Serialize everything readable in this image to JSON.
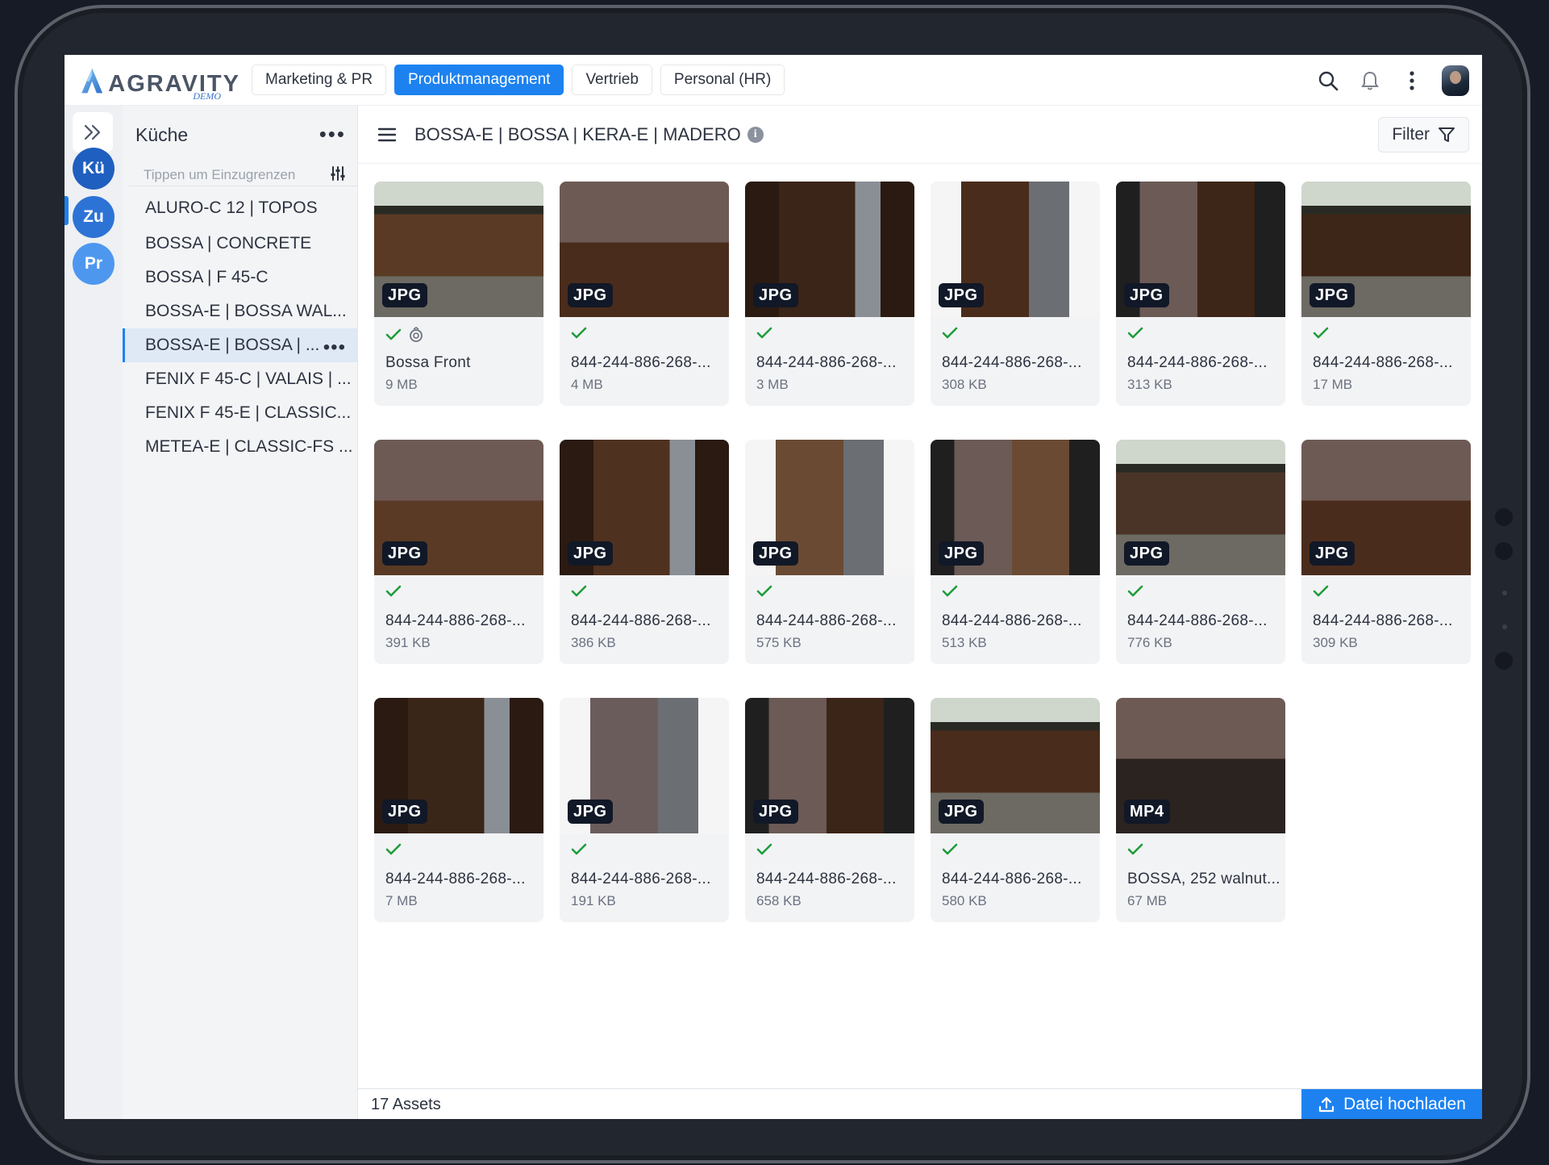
{
  "app": {
    "logo_text": "AGRAVITY",
    "logo_sub": "DEMO"
  },
  "tabs": [
    {
      "label": "Marketing & PR",
      "active": false
    },
    {
      "label": "Produktmanagement",
      "active": true
    },
    {
      "label": "Vertrieb",
      "active": false
    },
    {
      "label": "Personal (HR)",
      "active": false
    }
  ],
  "top_actions": [
    "search-icon",
    "bell-icon",
    "more-vertical-icon",
    "user-avatar"
  ],
  "rail": {
    "items": [
      {
        "label": "Kü",
        "color": "#1f5fbf"
      },
      {
        "label": "Zu",
        "color": "#2d73d6"
      },
      {
        "label": "Pr",
        "color": "#4e97ef"
      }
    ]
  },
  "tree": {
    "title": "Küche",
    "search_placeholder": "Tippen um Einzugrenzen",
    "items": [
      {
        "label": "ALURO-C 12 | TOPOS"
      },
      {
        "label": "BOSSA | CONCRETE"
      },
      {
        "label": "BOSSA | F 45-C"
      },
      {
        "label": "BOSSA-E | BOSSA WAL..."
      },
      {
        "label": "BOSSA-E | BOSSA | ...",
        "selected": true
      },
      {
        "label": "FENIX F 45-C | VALAIS | ..."
      },
      {
        "label": "FENIX F 45-E | CLASSIC..."
      },
      {
        "label": "METEA-E | CLASSIC-FS ..."
      }
    ]
  },
  "main": {
    "breadcrumb": "BOSSA-E | BOSSA | KERA-E | MADERO",
    "filter_label": "Filter",
    "assets": [
      {
        "type": "JPG",
        "name": "Bossa Front",
        "size": "9 MB",
        "extra_icon": true,
        "tone": "#5a3a24"
      },
      {
        "type": "JPG",
        "name": "844-244-886-268-...",
        "size": "4 MB",
        "tone": "#4a2c1c"
      },
      {
        "type": "JPG",
        "name": "844-244-886-268-...",
        "size": "3 MB",
        "tone": "#3b2418"
      },
      {
        "type": "JPG",
        "name": "844-244-886-268-...",
        "size": "308 KB",
        "tone": "#4a2c1c"
      },
      {
        "type": "JPG",
        "name": "844-244-886-268-...",
        "size": "313 KB",
        "tone": "#3d2517"
      },
      {
        "type": "JPG",
        "name": "844-244-886-268-...",
        "size": "17 MB",
        "tone": "#3d2517"
      },
      {
        "type": "JPG",
        "name": "844-244-886-268-...",
        "size": "391 KB",
        "tone": "#5a3a24"
      },
      {
        "type": "JPG",
        "name": "844-244-886-268-...",
        "size": "386 KB",
        "tone": "#4f3120"
      },
      {
        "type": "JPG",
        "name": "844-244-886-268-...",
        "size": "575 KB",
        "tone": "#6a4a33"
      },
      {
        "type": "JPG",
        "name": "844-244-886-268-...",
        "size": "513 KB",
        "tone": "#6a4a33"
      },
      {
        "type": "JPG",
        "name": "844-244-886-268-...",
        "size": "776 KB",
        "tone": "#4a3428"
      },
      {
        "type": "JPG",
        "name": "844-244-886-268-...",
        "size": "309 KB",
        "tone": "#4a2c1c"
      },
      {
        "type": "JPG",
        "name": "844-244-886-268-...",
        "size": "7 MB",
        "tone": "#3a2618"
      },
      {
        "type": "JPG",
        "name": "844-244-886-268-...",
        "size": "191 KB",
        "tone": "#6b5c5c"
      },
      {
        "type": "JPG",
        "name": "844-244-886-268-...",
        "size": "658 KB",
        "tone": "#3b2418"
      },
      {
        "type": "JPG",
        "name": "844-244-886-268-...",
        "size": "580 KB",
        "tone": "#4a2c1c"
      },
      {
        "type": "MP4",
        "name": "BOSSA, 252 walnut...",
        "size": "67 MB",
        "tone": "#2b2320"
      }
    ]
  },
  "footer": {
    "asset_count": "17 Assets",
    "upload_label": "Datei hochladen"
  },
  "colors": {
    "accent": "#1d82f0",
    "check": "#1f9d3a"
  }
}
